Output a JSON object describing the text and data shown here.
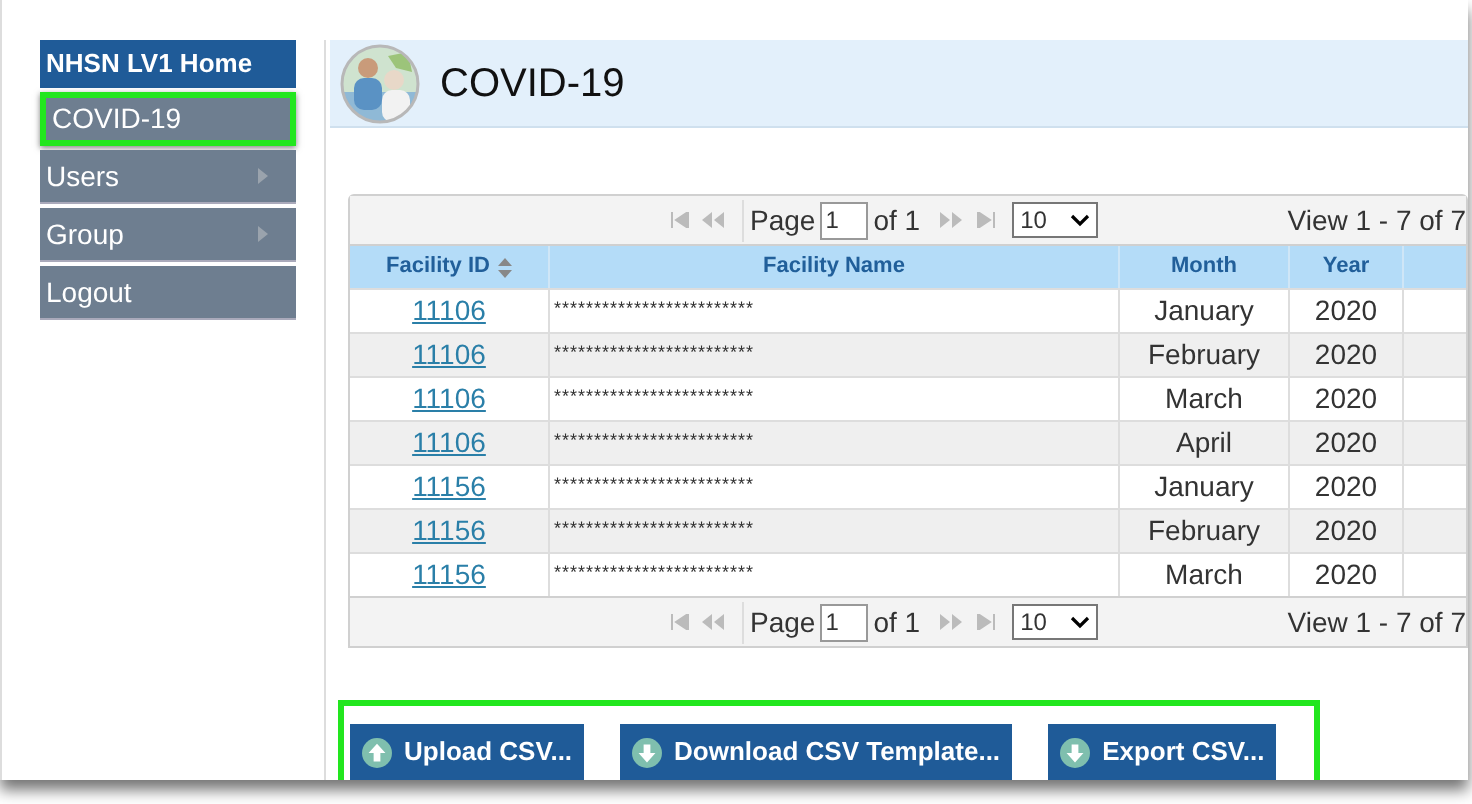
{
  "sidebar": {
    "title": "NHSN LV1 Home",
    "items": [
      {
        "label": "COVID-19",
        "has_submenu": false,
        "highlighted": true
      },
      {
        "label": "Users",
        "has_submenu": true,
        "highlighted": false
      },
      {
        "label": "Group",
        "has_submenu": true,
        "highlighted": false
      },
      {
        "label": "Logout",
        "has_submenu": false,
        "highlighted": false
      }
    ]
  },
  "header": {
    "title": "COVID-19"
  },
  "pagers": [
    {
      "page_label": "Page",
      "page_value": "1",
      "of_label": "of 1",
      "page_size": "10",
      "view_text": "View 1 - 7 of 7"
    },
    {
      "page_label": "Page",
      "page_value": "1",
      "of_label": "of 1",
      "page_size": "10",
      "view_text": "View 1 - 7 of 7"
    }
  ],
  "table": {
    "columns": [
      {
        "label": "Facility ID",
        "sortable": true
      },
      {
        "label": "Facility Name",
        "sortable": false
      },
      {
        "label": "Month",
        "sortable": false
      },
      {
        "label": "Year",
        "sortable": false
      }
    ],
    "rows": [
      [
        "11106",
        "*************************",
        "January",
        "2020"
      ],
      [
        "11106",
        "*************************",
        "February",
        "2020"
      ],
      [
        "11106",
        "*************************",
        "March",
        "2020"
      ],
      [
        "11106",
        "*************************",
        "April",
        "2020"
      ],
      [
        "11156",
        "*************************",
        "January",
        "2020"
      ],
      [
        "11156",
        "*************************",
        "February",
        "2020"
      ],
      [
        "11156",
        "*************************",
        "March",
        "2020"
      ]
    ]
  },
  "actions": {
    "highlighted": true,
    "buttons": [
      {
        "label": "Upload CSV...",
        "kind": "upload"
      },
      {
        "label": "Download CSV Template...",
        "kind": "download"
      },
      {
        "label": "Export CSV...",
        "kind": "download"
      }
    ]
  }
}
